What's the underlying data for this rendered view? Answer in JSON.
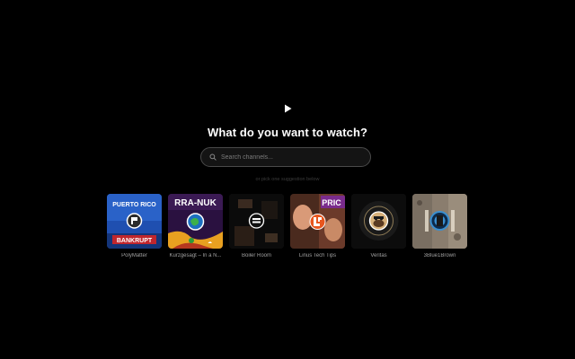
{
  "app": {
    "logo_icon": "play-icon",
    "headline": "What do you want to watch?"
  },
  "search": {
    "placeholder": "Search channels...",
    "value": "",
    "icon": "search-icon"
  },
  "hint": "or pick one suggestion below",
  "channels": [
    {
      "name": "PolyMatter",
      "thumb_texts": [
        "PUERTO RICO",
        "BANKRUPT"
      ],
      "colors": [
        "#1f4fb0",
        "#c0262d"
      ]
    },
    {
      "name": "Kurzgesagt – In a N...",
      "thumb_texts": [
        "RRA-NUK"
      ],
      "colors": [
        "#2a1140",
        "#e8a020"
      ]
    },
    {
      "name": "Boiler Room",
      "thumb_texts": [],
      "colors": [
        "#0b0b0b",
        "#3a2a20"
      ]
    },
    {
      "name": "Linus Tech Tips",
      "thumb_texts": [
        "PRIC"
      ],
      "colors": [
        "#b3202a",
        "#f47a20"
      ]
    },
    {
      "name": "Veritas",
      "thumb_texts": [],
      "colors": [
        "#0c0c0c",
        "#e0c080"
      ]
    },
    {
      "name": "3Blue1Brown",
      "thumb_texts": [],
      "colors": [
        "#8a7d6e",
        "#3a8fd0"
      ]
    }
  ],
  "colors": {
    "background": "#000000",
    "text": "#ffffff",
    "muted": "#a0a0a0",
    "search_border": "#4a4a4a"
  }
}
